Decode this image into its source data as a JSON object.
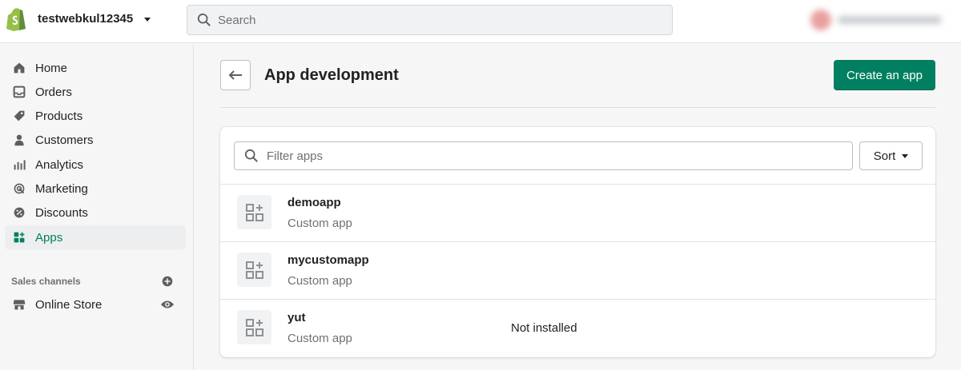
{
  "header": {
    "store_name": "testwebkul12345",
    "search_placeholder": "Search"
  },
  "sidebar": {
    "items": [
      {
        "label": "Home",
        "icon": "home-icon"
      },
      {
        "label": "Orders",
        "icon": "inbox-icon"
      },
      {
        "label": "Products",
        "icon": "tag-icon"
      },
      {
        "label": "Customers",
        "icon": "person-icon"
      },
      {
        "label": "Analytics",
        "icon": "bar-chart-icon"
      },
      {
        "label": "Marketing",
        "icon": "target-icon"
      },
      {
        "label": "Discounts",
        "icon": "discount-icon"
      },
      {
        "label": "Apps",
        "icon": "apps-icon",
        "active": true
      }
    ],
    "sales_channels_label": "Sales channels",
    "channels": [
      {
        "label": "Online Store",
        "icon": "store-icon"
      }
    ]
  },
  "page": {
    "title": "App development",
    "create_label": "Create an app",
    "filter_placeholder": "Filter apps",
    "sort_label": "Sort"
  },
  "apps": [
    {
      "name": "demoapp",
      "type": "Custom app",
      "status": ""
    },
    {
      "name": "mycustomapp",
      "type": "Custom app",
      "status": ""
    },
    {
      "name": "yut",
      "type": "Custom app",
      "status": "Not installed"
    }
  ],
  "colors": {
    "accent": "#008060",
    "text": "#202223",
    "subdued": "#6d7175"
  }
}
